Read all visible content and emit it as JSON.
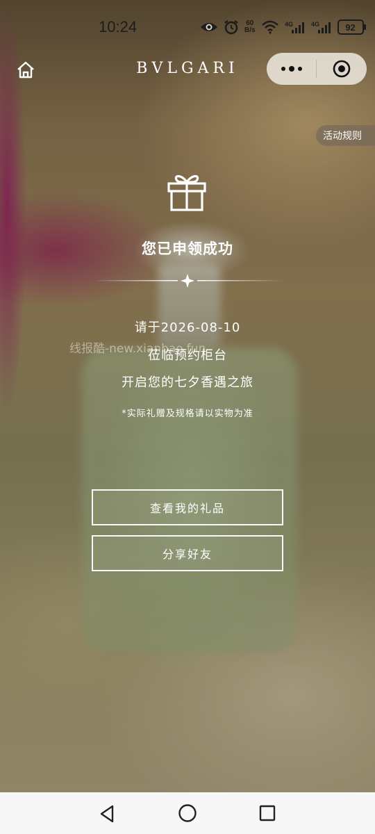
{
  "status_bar": {
    "time": "10:24",
    "net_speed_value": "60",
    "net_speed_unit": "B/s",
    "signal1_label": "4G",
    "signal2_label": "4G",
    "battery": "92",
    "icons": [
      "eye-icon",
      "alarm-icon",
      "wifi-icon",
      "signal-icon",
      "signal-icon",
      "battery-icon"
    ]
  },
  "header": {
    "brand": "BVLGARI",
    "home_icon": "home-icon",
    "more_icon": "more-dots-icon",
    "close_icon": "target-close-icon"
  },
  "rules_tab": "活动规则",
  "main": {
    "icon": "gift-icon",
    "title": "您已申领成功",
    "date_line": "请于2026-08-10",
    "line2": "莅临预约柜台",
    "line3": "开启您的七夕香遇之旅",
    "note": "*实际礼赠及规格请以实物为准",
    "watermark": "线报酷-new.xianbao.fun"
  },
  "buttons": {
    "view_gift": "查看我的礼品",
    "share": "分享好友"
  },
  "nav_bar": {
    "icons": [
      "back-icon",
      "home-circle-icon",
      "recent-apps-icon"
    ]
  }
}
